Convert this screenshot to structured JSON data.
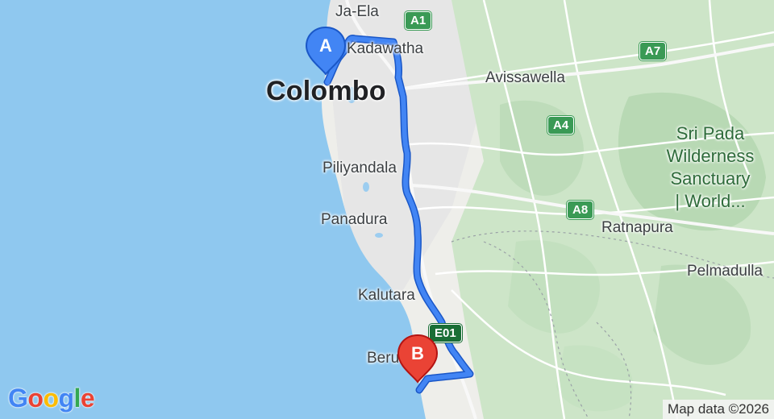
{
  "map": {
    "route": {
      "start_label": "A",
      "end_label": "B",
      "route_color": "#4285f4",
      "start_color": "#4285f4",
      "end_color": "#ea4335"
    },
    "places": {
      "colombo": "Colombo",
      "ja_ela": "Ja-Ela",
      "kadawatha": "Kadawatha",
      "avissawella": "Avissawella",
      "piliyandala": "Piliyandala",
      "panadura": "Panadura",
      "kalutara": "Kalutara",
      "beruwala": "Beruwala",
      "ratnapura": "Ratnapura",
      "pelmadulla": "Pelmadulla"
    },
    "park": {
      "line1": "Sri Pada",
      "line2": "Wilderness",
      "line3": "Sanctuary",
      "line4": "| World..."
    },
    "shields": {
      "a1": "A1",
      "a7": "A7",
      "a4": "A4",
      "a8": "A8",
      "e01": "E01"
    },
    "logo_text": "Google",
    "logo_colors": [
      "#4285f4",
      "#ea4335",
      "#fbbc05",
      "#4285f4",
      "#34a853",
      "#ea4335"
    ],
    "attribution": "Map data ©2026",
    "colors": {
      "sea": "#8fc8ef",
      "land": "#f1f1ee",
      "forest": "#cfe6cb"
    }
  }
}
